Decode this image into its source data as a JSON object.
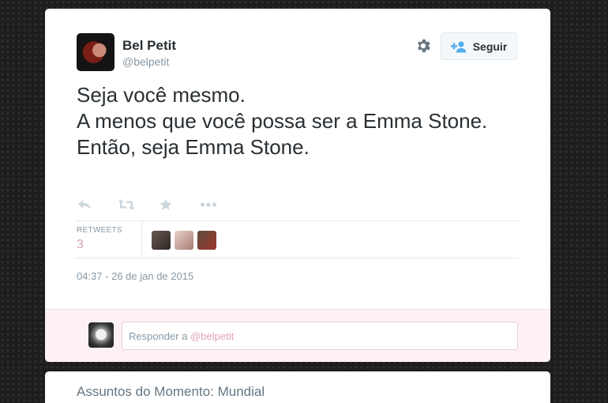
{
  "tweet": {
    "author_name": "Bel Petit",
    "handle": "@belpetit",
    "text": "Seja você mesmo.\nA menos que você possa ser a Emma Stone.\nEntão, seja Emma Stone.",
    "timestamp": "04:37 - 26 de jan de 2015",
    "follow_label": "Seguir",
    "stats": {
      "retweets_label": "RETWEETS",
      "retweets_count": "3"
    },
    "actions": [
      "reply-icon",
      "retweet-icon",
      "favorite-icon",
      "more-icon"
    ]
  },
  "reply": {
    "prefix": "Responder a ",
    "mention": "@belpetit"
  },
  "next_card": {
    "title": "Assuntos do Momento: Mundial"
  },
  "colors": {
    "accent_pink": "#e0a3b3",
    "reply_bg": "#fdf1f3",
    "follow_icon": "#55acee",
    "muted": "#8899a6",
    "text": "#292f33"
  }
}
